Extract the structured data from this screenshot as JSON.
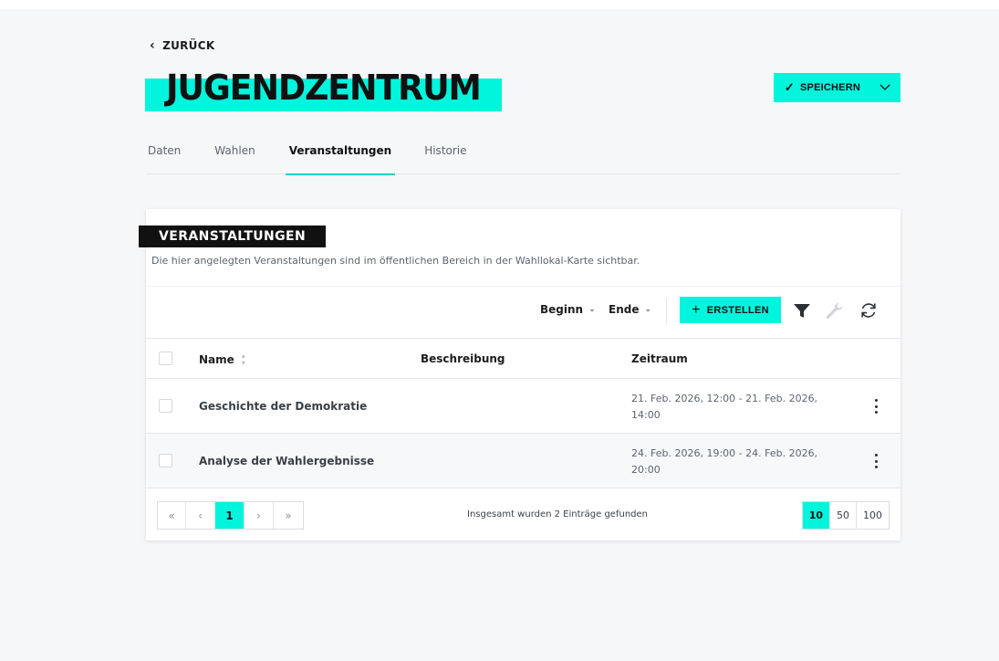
{
  "nav": {
    "back_label": "ZURÜCK"
  },
  "header": {
    "title": "JUGENDZENTRUM",
    "save_label": "SPEICHERN"
  },
  "tabs": [
    {
      "label": "Daten",
      "active": false
    },
    {
      "label": "Wahlen",
      "active": false
    },
    {
      "label": "Veranstaltungen",
      "active": true
    },
    {
      "label": "Historie",
      "active": false
    }
  ],
  "section": {
    "title": "VERANSTALTUNGEN",
    "description": "Die hier angelegten Veranstaltungen sind im öffentlichen Bereich in der Wahllokal-Karte sichtbar."
  },
  "toolbar": {
    "sort_beginn": "Beginn",
    "sort_ende": "Ende",
    "create_label": "ERSTELLEN",
    "icons": [
      "filter-icon",
      "wrench-icon",
      "refresh-icon"
    ]
  },
  "table": {
    "columns": {
      "name": "Name",
      "description": "Beschreibung",
      "range": "Zeitraum"
    },
    "rows": [
      {
        "name": "Geschichte der Demokratie",
        "description": "",
        "range": "21. Feb. 2026, 12:00 - 21. Feb. 2026, 14:00"
      },
      {
        "name": "Analyse der Wahlergebnisse",
        "description": "",
        "range": "24. Feb. 2026, 19:00 - 24. Feb. 2026, 20:00"
      }
    ]
  },
  "pagination": {
    "current_page": "1",
    "total_text": "Insgesamt wurden 2 Einträge gefunden",
    "page_sizes": [
      "10",
      "50",
      "100"
    ],
    "active_size": "10"
  },
  "colors": {
    "accent": "#00f5dc",
    "label_bg": "#111111"
  }
}
